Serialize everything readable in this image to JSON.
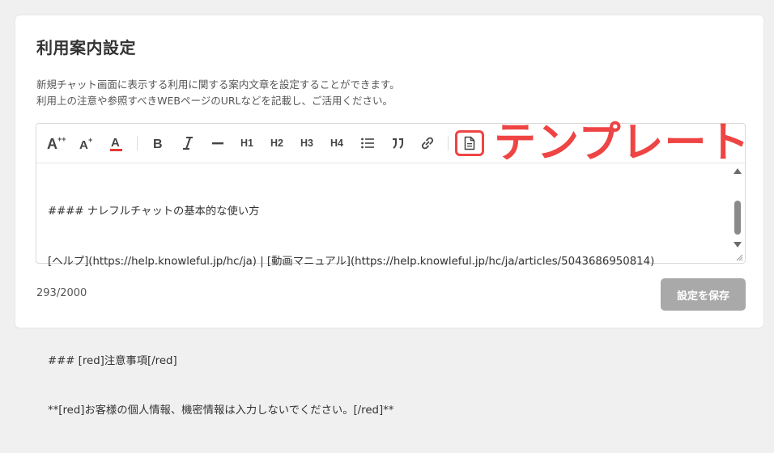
{
  "settings": {
    "title": "利用案内設定",
    "description_lines": [
      "新規チャット画面に表示する利用に関する案内文章を設定することができます。",
      "利用上の注意や参照すべきWEBページのURLなどを記載し、ご活用ください。"
    ]
  },
  "toolbar": {
    "h1": "H1",
    "h2": "H2",
    "h3": "H3",
    "h4": "H4"
  },
  "editor": {
    "lines": [
      "#### ナレフルチャットの基本的な使い方",
      "[ヘルプ](https://help.knowleful.jp/hc/ja) | [動画マニュアル](https://help.knowleful.jp/hc/ja/articles/5043686950814)",
      "",
      "### [red]注意事項[/red]",
      "**[red]お客様の個人情報、機密情報は入力しないでください。[/red]**"
    ]
  },
  "footer": {
    "counter": "293/2000",
    "save_label": "設定を保存"
  },
  "annotation": {
    "label": "テンプレート",
    "color": "#ef4444"
  },
  "colors": {
    "save_button_bg": "#a9a9a9",
    "highlight": "#ef4444"
  }
}
